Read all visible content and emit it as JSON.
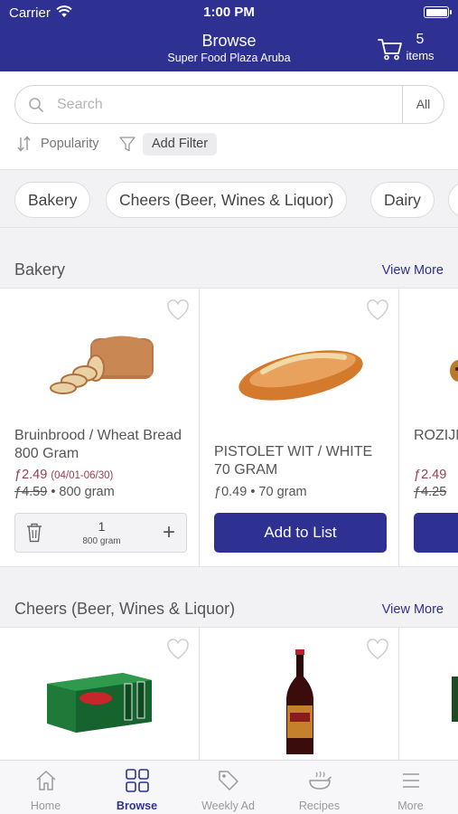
{
  "status_bar": {
    "carrier": "Carrier",
    "time": "1:00 PM"
  },
  "header": {
    "title": "Browse",
    "subtitle": "Super Food Plaza Aruba",
    "cart_count": "5",
    "cart_unit": "items"
  },
  "search": {
    "placeholder": "Search",
    "scope": "All"
  },
  "sort": {
    "label": "Popularity"
  },
  "filter": {
    "label": "Add Filter"
  },
  "chips": [
    "Bakery",
    "Cheers (Beer, Wines & Liquor)",
    "Dairy"
  ],
  "sections": [
    {
      "title": "Bakery",
      "view_more": "View More",
      "products": [
        {
          "name": "Bruinbrood / Wheat Bread 800 Gram",
          "sale_price": "ƒ2.49",
          "sale_dates": "(04/01-06/30)",
          "reg_price": "ƒ4.59",
          "size": "• 800 gram",
          "qty": "1",
          "qty_unit": "800 gram"
        },
        {
          "name": "PISTOLET WIT / WHITE 70 GRAM",
          "reg_price": "ƒ0.49",
          "size": "• 70 gram",
          "button": "Add to List"
        },
        {
          "name": "ROZIJNEN RAISIN",
          "sale_price": "ƒ2.49",
          "reg_price": "ƒ4.25"
        }
      ]
    },
    {
      "title": "Cheers (Beer, Wines & Liquor)",
      "view_more": "View More"
    }
  ],
  "tabs": [
    {
      "label": "Home",
      "icon": "home-icon"
    },
    {
      "label": "Browse",
      "icon": "grid-icon",
      "active": true
    },
    {
      "label": "Weekly Ad",
      "icon": "tag-icon"
    },
    {
      "label": "Recipes",
      "icon": "cooking-pot-icon"
    },
    {
      "label": "More",
      "icon": "menu-icon"
    }
  ],
  "colors": {
    "brand": "#2e3192",
    "sale": "#9b3b4e",
    "background": "#f2f2f4"
  }
}
